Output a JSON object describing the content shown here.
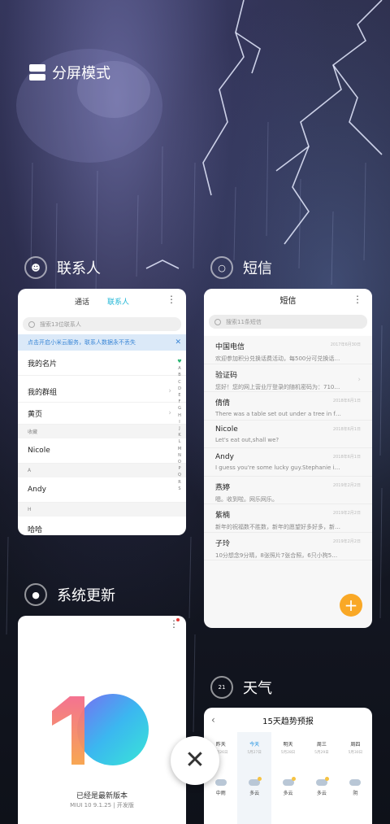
{
  "split_screen": {
    "label": "分屏模式"
  },
  "contacts_app": {
    "label": "联系人",
    "tabs": [
      "通话",
      "联系人"
    ],
    "search_placeholder": "搜索13位联系人",
    "banner": "点击开启小米云服务，联系人数据永不丢失",
    "rows": {
      "my_card": "我的名片",
      "my_groups": "我的群组",
      "yellow_pages": "黄页"
    },
    "sections": {
      "favorites": "收藏",
      "a": "A",
      "h": "H"
    },
    "contacts": {
      "nicole": "Nicole",
      "andy": "Andy",
      "haha": "哈哈"
    },
    "alphabet": [
      "A",
      "B",
      "C",
      "D",
      "E",
      "F",
      "G",
      "H",
      "I",
      "J",
      "K",
      "L",
      "M",
      "N",
      "O",
      "P",
      "Q",
      "R",
      "S"
    ]
  },
  "sms_app": {
    "label": "短信",
    "title": "短信",
    "search_placeholder": "搜索11条短信",
    "messages": [
      {
        "name": "中国电信",
        "preview": "欢迎参加积分兑换话费活动，每500分可兑换话费...",
        "date": "2017年6月30日"
      },
      {
        "name": "验证码",
        "preview": "您好！您的网上营业厅登录的随机密码为：71067...",
        "date": ""
      },
      {
        "name": "倩倩",
        "preview": "There was a table set out under a tree in front o...",
        "date": "2018年6月1日"
      },
      {
        "name": "Nicole",
        "preview": "Let's eat out,shall we?",
        "date": "2018年6月1日"
      },
      {
        "name": "Andy",
        "preview": "I guess you're some lucky guy.Stephanie is a n...",
        "date": "2018年6月1日"
      },
      {
        "name": "燕婷",
        "preview": "嗯。收到啦。网乐网乐。",
        "date": "2019年2月2日"
      },
      {
        "name": "紫楠",
        "preview": "新年的祝福数不胜数，新年的愿望好多好多，新年...",
        "date": "2019年2月2日"
      },
      {
        "name": "子玲",
        "preview": "10分想念9分晴，8张照片7张合照，6只小狗5只...",
        "date": "2019年2月2日"
      }
    ]
  },
  "update_app": {
    "label": "系统更新",
    "status": "已经是最新版本",
    "version": "MIUI 10 9.1.25 | 开发版"
  },
  "weather_app": {
    "label": "天气",
    "title": "15天趋势预报",
    "days": [
      {
        "name": "昨天",
        "date": "5月26日",
        "cond": "中雨",
        "sun": false
      },
      {
        "name": "今天",
        "date": "5月27日",
        "cond": "多云",
        "sun": true
      },
      {
        "name": "明天",
        "date": "5月28日",
        "cond": "多云",
        "sun": true
      },
      {
        "name": "周三",
        "date": "5月29日",
        "cond": "多云",
        "sun": true
      },
      {
        "name": "周四",
        "date": "5月30日",
        "cond": "阴",
        "sun": false
      }
    ]
  },
  "close_button": {
    "icon": "close-icon"
  },
  "colors": {
    "accent_blue": "#1fb6d6",
    "fab_orange": "#f9a826"
  }
}
